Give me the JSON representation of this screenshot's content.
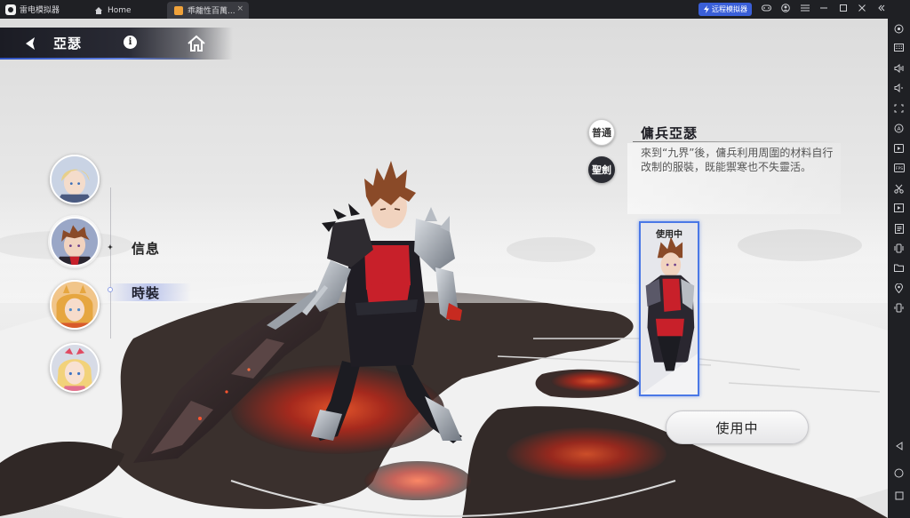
{
  "emulator": {
    "brand": "雷电模拟器",
    "tabs": [
      {
        "label": "Home"
      },
      {
        "label": "乖離性百萬..."
      }
    ],
    "tab_close": "×",
    "remote_button": "远程模拟器",
    "toolbar_icons": [
      "gamepad-icon",
      "user-icon",
      "menu-icon",
      "minimize-icon",
      "maximize-icon",
      "close-icon",
      "collapse-icon"
    ],
    "sidebar_icons": [
      "settings-icon",
      "keyboard-icon",
      "volume-up-icon",
      "volume-down-icon",
      "screenshot-icon",
      "auto-icon",
      "record-icon",
      "fps-icon",
      "scissors-icon",
      "video-icon",
      "notes-icon",
      "shake-icon",
      "folder-icon",
      "location-icon",
      "rotate-icon",
      "back-nav-icon",
      "home-nav-icon",
      "recent-nav-icon"
    ]
  },
  "header": {
    "character_name": "亞瑟",
    "info_symbol": "i"
  },
  "menu": {
    "items": [
      {
        "label": "信息"
      },
      {
        "label": "時裝"
      }
    ],
    "active_index": 1
  },
  "portraits": [
    "portrait-blonde-knight",
    "portrait-arthur",
    "portrait-lion-girl",
    "portrait-blonde-girl"
  ],
  "costume_panel": {
    "mode_normal": "普通",
    "mode_sword": "聖劍",
    "title": "傭兵亞瑟",
    "description": "來到“九界”後，傭兵利用周圍的材料自行改制的服裝，既能禦寒也不失靈活。",
    "card_label": "使用中",
    "use_button": "使用中"
  },
  "colors": {
    "accent_blue": "#4a78e6",
    "lava_red": "#e0391c",
    "dark_rock": "#2e2826"
  }
}
